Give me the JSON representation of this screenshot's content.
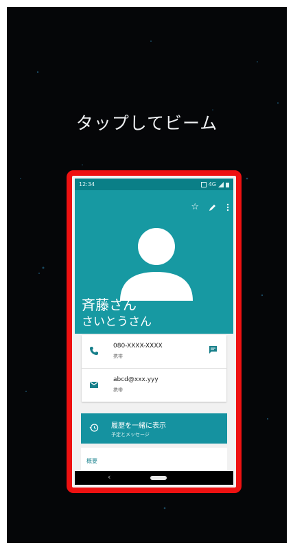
{
  "instruction": "タップしてビーム",
  "phone": {
    "status_bar": {
      "time": "12:34",
      "network": "4G"
    },
    "toolbar": {
      "star_icon": "star-outline-icon",
      "edit_icon": "pencil-icon",
      "more_icon": "more-vertical-icon"
    },
    "contact": {
      "name": "斉藤さん",
      "reading": "さいとうさん",
      "phone": {
        "number": "080-XXXX-XXXX",
        "label": "携帯"
      },
      "email": {
        "address": "abcd@xxx.yyy",
        "label": "携帯"
      }
    },
    "history": {
      "title": "履歴を一緒に表示",
      "subtitle": "予定とメッセージ"
    },
    "summary_label": "概要"
  },
  "colors": {
    "highlight": "#ee1111",
    "teal": "#1799a2",
    "status_teal": "#0a7f87",
    "background": "#050608"
  }
}
